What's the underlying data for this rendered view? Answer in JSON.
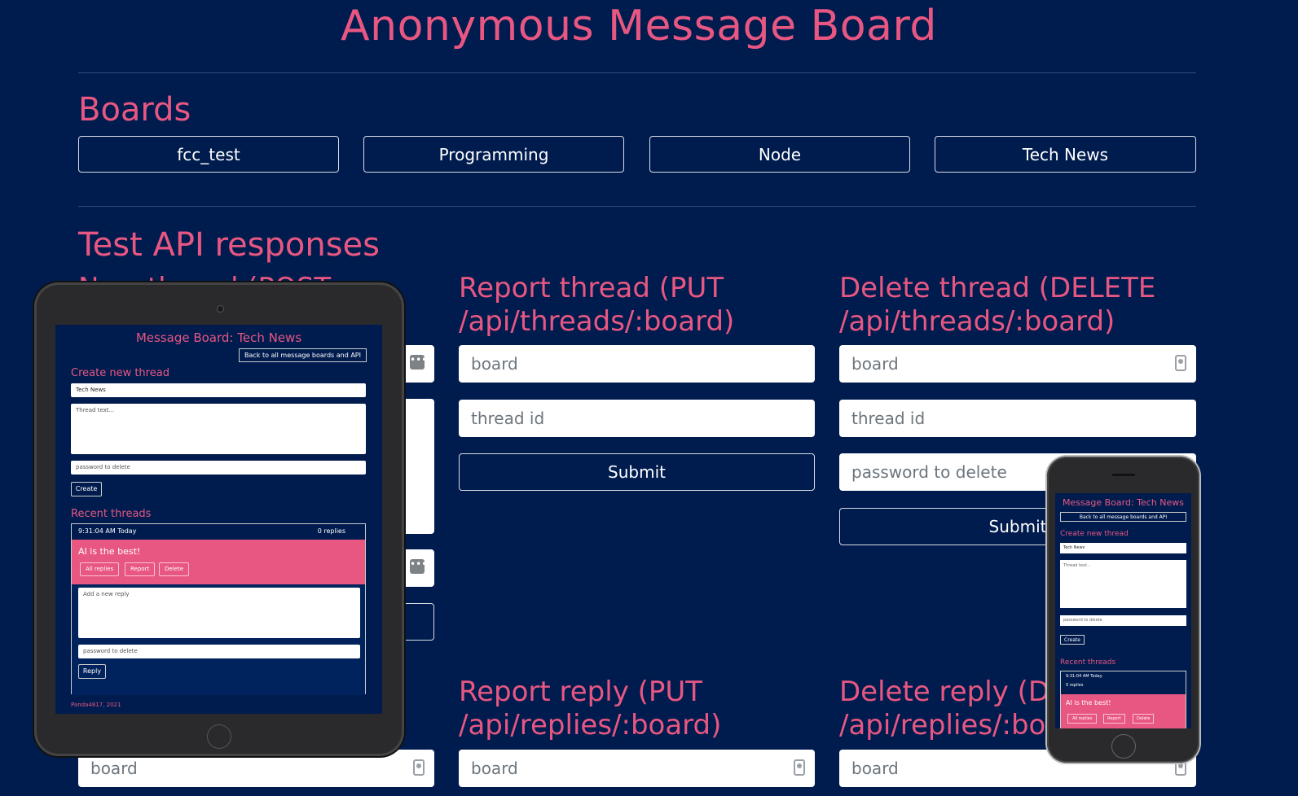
{
  "header": {
    "title": "Anonymous Message Board"
  },
  "boards": {
    "heading": "Boards",
    "items": [
      {
        "label": "fcc_test"
      },
      {
        "label": "Programming"
      },
      {
        "label": "Node"
      },
      {
        "label": "Tech News"
      }
    ]
  },
  "test_api": {
    "heading": "Test API responses",
    "new_thread_heading_partial": "New thread (POST",
    "report_thread": {
      "heading_line1": "Report thread (PUT",
      "heading_line2": "/api/threads/:board)",
      "board_placeholder": "board",
      "thread_id_placeholder": "thread id",
      "submit_label": "Submit"
    },
    "delete_thread": {
      "heading_line1": "Delete thread (DELETE",
      "heading_line2": "/api/threads/:board)",
      "board_placeholder": "board",
      "thread_id_placeholder": "thread id",
      "password_placeholder": "password to delete",
      "submit_label": "Submit"
    },
    "report_reply": {
      "heading_line1": "Report reply (PUT",
      "heading_line2": "/api/replies/:board)",
      "board_placeholder": "board"
    },
    "delete_reply": {
      "heading_line1": "Delete reply (DE",
      "heading_line2": "/api/replies/:boa",
      "board_placeholder": "board"
    },
    "new_reply": {
      "board_placeholder": "board"
    }
  },
  "tablet_preview": {
    "title": "Message Board: Tech News",
    "back_link": "Back to all message boards and API",
    "create_heading": "Create new thread",
    "board_value": "Tech News",
    "thread_text_placeholder": "Thread text...",
    "password_placeholder": "password to delete",
    "create_label": "Create",
    "recent_heading": "Recent threads",
    "thread_time": "9:31:04 AM Today",
    "thread_replies": "0 replies",
    "thread_text": "AI is the best!",
    "all_replies_label": "All replies",
    "report_label": "Report",
    "delete_label": "Delete",
    "reply_placeholder": "Add a new reply",
    "reply_password_placeholder": "password to delete",
    "reply_label": "Reply",
    "footer": "Panda4817, 2021"
  },
  "phone_preview": {
    "title": "Message Board: Tech News",
    "back_link": "Back to all message boards and API",
    "create_heading": "Create new thread",
    "board_value": "Tech News",
    "thread_text_placeholder": "Thread text...",
    "password_placeholder": "password to delete",
    "create_label": "Create",
    "recent_heading": "Recent threads",
    "thread_time": "9:31:04 AM Today",
    "thread_replies": "0 replies",
    "thread_text": "AI is the best!",
    "all_replies_label": "All replies",
    "report_label": "Report",
    "delete_label": "Delete"
  },
  "colors": {
    "background": "#001c4e",
    "accent": "#e85782"
  }
}
